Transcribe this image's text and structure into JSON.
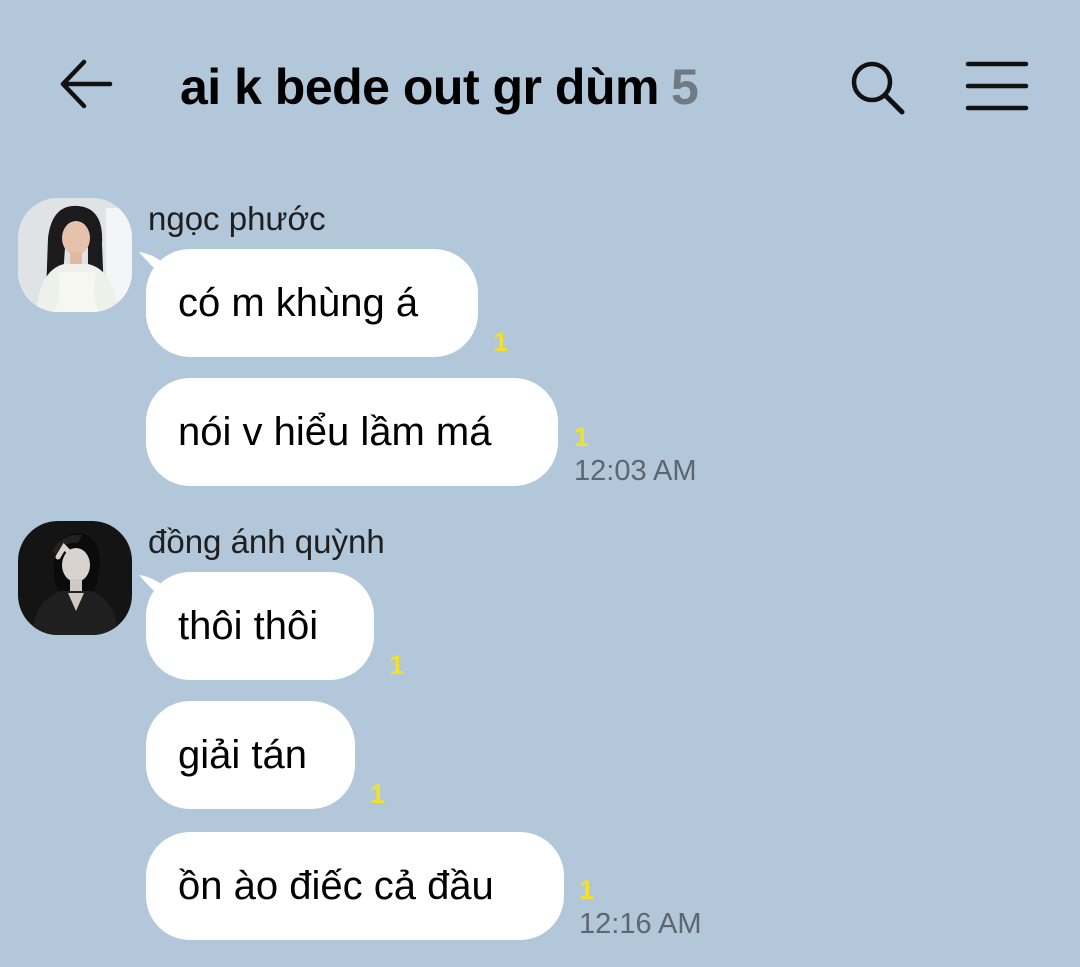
{
  "header": {
    "title": "ai k bede out gr dùm",
    "member_count": "5",
    "back_icon": "back-arrow-icon",
    "search_icon": "search-icon",
    "menu_icon": "hamburger-menu-icon"
  },
  "colors": {
    "background": "#b2c7da",
    "bubble": "#ffffff",
    "unread_count": "#f2e12c",
    "timestamp": "#5d6671",
    "member_count": "#6f7a84"
  },
  "groups": [
    {
      "sender": "ngọc phước",
      "messages": [
        {
          "text": "có m khùng á",
          "unread": "1"
        },
        {
          "text": "nói v hiểu lầm má",
          "unread": "1",
          "time": "12:03 AM"
        }
      ]
    },
    {
      "sender": "đồng ánh quỳnh",
      "messages": [
        {
          "text": "thôi thôi",
          "unread": "1"
        },
        {
          "text": "giải tán",
          "unread": "1"
        },
        {
          "text": "ồn ào điếc cả đầu",
          "unread": "1",
          "time": "12:16 AM"
        }
      ]
    }
  ]
}
